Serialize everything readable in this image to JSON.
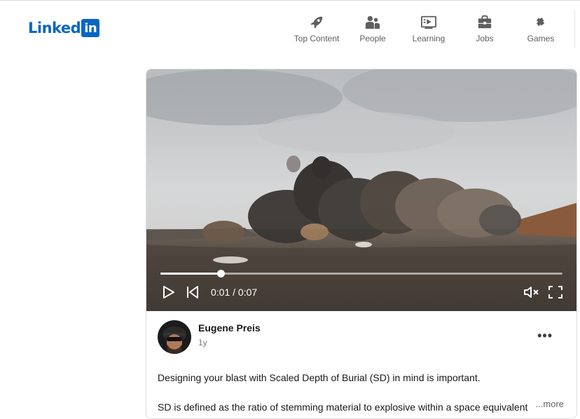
{
  "brand": {
    "logo_text": "Linked",
    "logo_box": "in",
    "color": "#0a66c2"
  },
  "nav": {
    "items": [
      {
        "label": "Top Content",
        "icon": "rocket-icon"
      },
      {
        "label": "People",
        "icon": "people-icon"
      },
      {
        "label": "Learning",
        "icon": "learning-icon"
      },
      {
        "label": "Jobs",
        "icon": "briefcase-icon"
      },
      {
        "label": "Games",
        "icon": "puzzle-icon"
      }
    ]
  },
  "video": {
    "time_display": "0:01 / 0:07",
    "progress_fraction": 0.15,
    "muted": true
  },
  "post": {
    "author": "Eugene Preis",
    "time_ago": "1y",
    "paragraph_1": "Designing your blast with Scaled Depth of Burial (SD) in mind is important.",
    "paragraph_2": "SD is defined as the ratio of stemming material to explosive within a space equivalent",
    "see_more": "...more"
  }
}
